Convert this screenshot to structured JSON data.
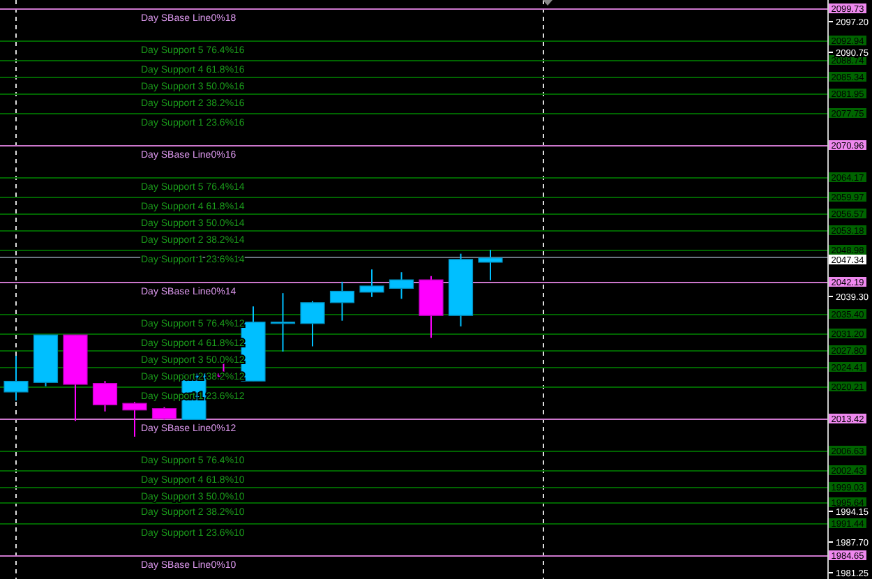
{
  "levels": [
    {
      "kind": "base",
      "label": "Day SBase Line0%18",
      "price": "2099.73"
    },
    {
      "kind": "support",
      "label": "Day Support 5 76.4%16",
      "price": "2092.94"
    },
    {
      "kind": "support",
      "label": "Day Support 4 61.8%16",
      "price": "2088.74"
    },
    {
      "kind": "support",
      "label": "Day Support 3 50.0%16",
      "price": "2085.34"
    },
    {
      "kind": "support",
      "label": "Day Support 2 38.2%16",
      "price": "2081.95"
    },
    {
      "kind": "support",
      "label": "Day Support 1 23.6%16",
      "price": "2077.75"
    },
    {
      "kind": "base",
      "label": "Day SBase Line0%16",
      "price": "2070.96"
    },
    {
      "kind": "support",
      "label": "Day Support 5 76.4%14",
      "price": "2064.17"
    },
    {
      "kind": "support",
      "label": "Day Support 4 61.8%14",
      "price": "2059.97"
    },
    {
      "kind": "support",
      "label": "Day Support 3 50.0%14",
      "price": "2056.57"
    },
    {
      "kind": "support",
      "label": "Day Support 2 38.2%14",
      "price": "2053.18"
    },
    {
      "kind": "support",
      "label": "Day Support 1 23.6%14",
      "price": "2048.98"
    },
    {
      "kind": "base",
      "label": "Day SBase Line0%14",
      "price": "2042.19"
    },
    {
      "kind": "support",
      "label": "Day Support 5 76.4%12",
      "price": "2035.40"
    },
    {
      "kind": "support",
      "label": "Day Support 4 61.8%12",
      "price": "2031.20"
    },
    {
      "kind": "support",
      "label": "Day Support 3 50.0%12",
      "price": "2027.80"
    },
    {
      "kind": "support",
      "label": "Day Support 2 38.2%12",
      "price": "2024.41"
    },
    {
      "kind": "support",
      "label": "Day Support 1 23.6%12",
      "price": "2020.21"
    },
    {
      "kind": "base",
      "label": "Day SBase Line0%12",
      "price": "2013.42"
    },
    {
      "kind": "support",
      "label": "Day Support 5 76.4%10",
      "price": "2006.63"
    },
    {
      "kind": "support",
      "label": "Day Support 4 61.8%10",
      "price": "2002.43"
    },
    {
      "kind": "support",
      "label": "Day Support 3 50.0%10",
      "price": "1999.03"
    },
    {
      "kind": "support",
      "label": "Day Support 2 38.2%10",
      "price": "1995.64"
    },
    {
      "kind": "support",
      "label": "Day Support 1 23.6%10",
      "price": "1991.44"
    },
    {
      "kind": "base",
      "label": "Day SBase Line0%10",
      "price": "1984.65"
    }
  ],
  "ticks": [
    "2097.20",
    "2090.75",
    "2039.30",
    "1994.15",
    "1987.70",
    "1981.25"
  ],
  "current_price": "2047.34"
}
